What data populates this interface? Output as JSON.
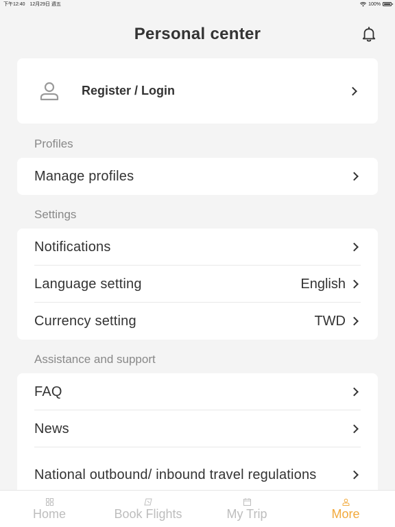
{
  "status_bar": {
    "time": "下午12:40",
    "date": "12月29日 週五",
    "battery": "100%"
  },
  "header": {
    "title": "Personal center"
  },
  "login": {
    "label": "Register / Login"
  },
  "profiles": {
    "section": "Profiles",
    "items": [
      {
        "label": "Manage profiles"
      }
    ]
  },
  "settings": {
    "section": "Settings",
    "items": [
      {
        "label": "Notifications",
        "value": ""
      },
      {
        "label": "Language setting",
        "value": "English"
      },
      {
        "label": "Currency setting",
        "value": "TWD"
      }
    ]
  },
  "support": {
    "section": "Assistance and support",
    "items": [
      {
        "label": "FAQ"
      },
      {
        "label": "News"
      },
      {
        "label": "National outbound/ inbound travel regulations"
      }
    ]
  },
  "tabs": [
    {
      "label": "Home",
      "icon": "grid-icon"
    },
    {
      "label": "Book Flights",
      "icon": "ticket-icon"
    },
    {
      "label": "My Trip",
      "icon": "calendar-icon"
    },
    {
      "label": "More",
      "icon": "person-icon"
    }
  ],
  "colors": {
    "accent": "#f2a93b",
    "background": "#f4f4f4",
    "inactive": "#bdbdbd"
  }
}
